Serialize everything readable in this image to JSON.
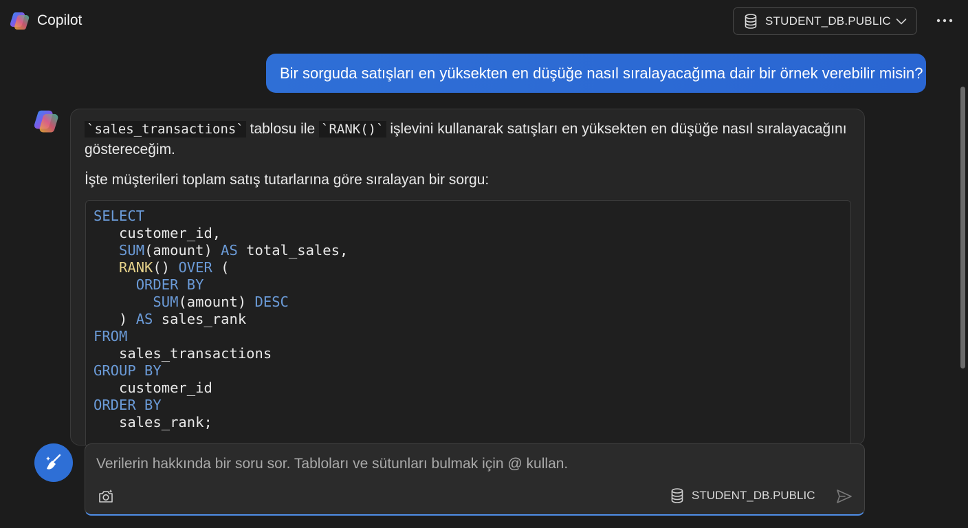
{
  "header": {
    "app_title": "Copilot",
    "database": "STUDENT_DB.PUBLIC",
    "more_icon": "ellipsis-icon"
  },
  "conversation": {
    "user_message": "Bir sorguda satışları en yüksekten en düşüğe nasıl sıralayacağıma dair bir örnek verebilir misin?",
    "assistant": {
      "para1": {
        "code1": "`sales_transactions`",
        "text1": " tablosu ile ",
        "code2": "`RANK()`",
        "text2": " işlevini kullanarak satışları en yüksekten en düşüğe nasıl sıralayacağını göstereceğim."
      },
      "para2": "İşte müşterileri toplam satış tutarlarına göre sıralayan bir sorgu:",
      "code": {
        "l1_kw": "SELECT",
        "l2": "customer_id,",
        "l3_fn": "SUM",
        "l3_a": "(amount) ",
        "l3_kw": "AS",
        "l3_b": " total_sales,",
        "l4_fn": "RANK",
        "l4_a": "() ",
        "l4_kw": "OVER",
        "l4_b": " (",
        "l5_kw": "ORDER BY",
        "l6_fn": "SUM",
        "l6_a": "(amount) ",
        "l6_kw": "DESC",
        "l7_a": ") ",
        "l7_kw": "AS",
        "l7_b": " sales_rank",
        "l8_kw": "FROM",
        "l9": "sales_transactions",
        "l10_kw": "GROUP BY",
        "l11": "customer_id",
        "l12_kw": "ORDER BY",
        "l13": "sales_rank;"
      }
    }
  },
  "composer": {
    "placeholder": "Verilerin hakkında bir soru sor. Tabloları ve sütunları bulmak için @ kullan.",
    "database": "STUDENT_DB.PUBLIC"
  },
  "colors": {
    "accent": "#2e6fd6",
    "keyword": "#6b9bd8",
    "function_highlight": "#e6d28a",
    "background": "#1c1c1c"
  }
}
